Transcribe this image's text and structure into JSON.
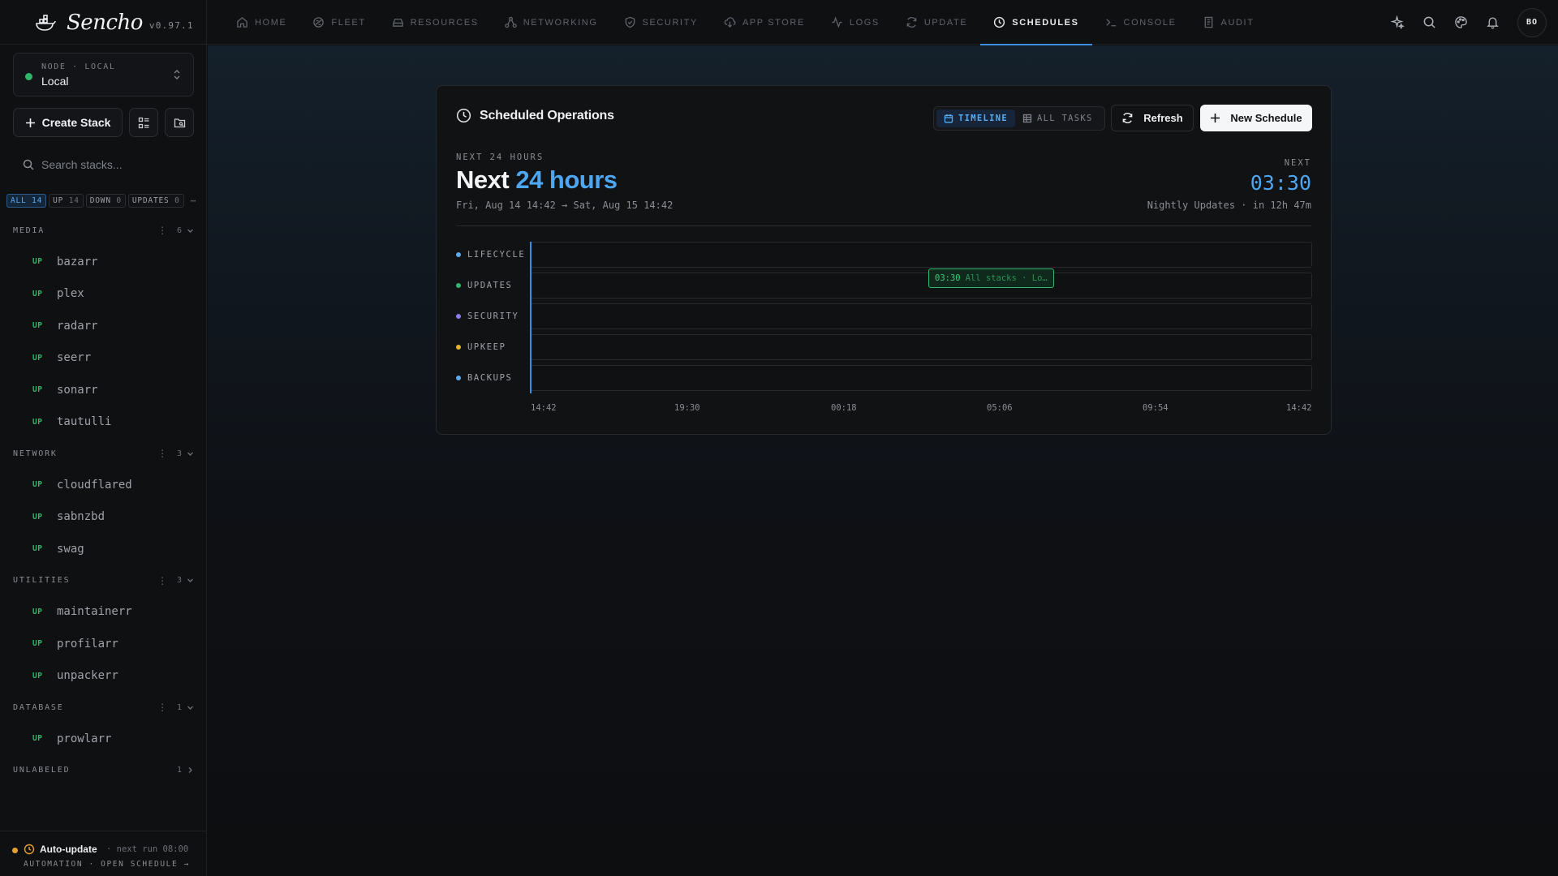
{
  "brand": {
    "name": "Sencho",
    "version": "v0.97.1"
  },
  "nav": [
    {
      "label": "HOME",
      "icon": "home-icon"
    },
    {
      "label": "FLEET",
      "icon": "fleet-icon"
    },
    {
      "label": "RESOURCES",
      "icon": "resources-icon"
    },
    {
      "label": "NETWORKING",
      "icon": "networking-icon"
    },
    {
      "label": "SECURITY",
      "icon": "shield-icon"
    },
    {
      "label": "APP STORE",
      "icon": "cloud-download-icon"
    },
    {
      "label": "LOGS",
      "icon": "activity-icon"
    },
    {
      "label": "UPDATE",
      "icon": "refresh-icon"
    },
    {
      "label": "SCHEDULES",
      "icon": "clock-icon",
      "active": true
    },
    {
      "label": "CONSOLE",
      "icon": "terminal-icon"
    },
    {
      "label": "AUDIT",
      "icon": "audit-icon"
    }
  ],
  "topbar": {
    "avatar_initials": "BO",
    "action_icons": [
      "sparkle-icon",
      "search-icon",
      "palette-icon",
      "bell-icon"
    ]
  },
  "sidebar": {
    "node": {
      "sublabel": "NODE · LOCAL",
      "name": "Local",
      "status_color": "#2fb56a"
    },
    "create_stack_label": "Create Stack",
    "search_placeholder": "Search stacks...",
    "filters": [
      {
        "label": "ALL",
        "count": "14",
        "active": true
      },
      {
        "label": "UP",
        "count": "14"
      },
      {
        "label": "DOWN",
        "count": "0"
      },
      {
        "label": "UPDATES",
        "count": "0"
      }
    ],
    "groups": [
      {
        "name": "MEDIA",
        "count": "6",
        "expanded": true,
        "stacks": [
          {
            "status": "UP",
            "name": "bazarr"
          },
          {
            "status": "UP",
            "name": "plex"
          },
          {
            "status": "UP",
            "name": "radarr"
          },
          {
            "status": "UP",
            "name": "seerr"
          },
          {
            "status": "UP",
            "name": "sonarr"
          },
          {
            "status": "UP",
            "name": "tautulli"
          }
        ]
      },
      {
        "name": "NETWORK",
        "count": "3",
        "expanded": true,
        "stacks": [
          {
            "status": "UP",
            "name": "cloudflared"
          },
          {
            "status": "UP",
            "name": "sabnzbd"
          },
          {
            "status": "UP",
            "name": "swag"
          }
        ]
      },
      {
        "name": "UTILITIES",
        "count": "3",
        "expanded": true,
        "stacks": [
          {
            "status": "UP",
            "name": "maintainerr"
          },
          {
            "status": "UP",
            "name": "profilarr"
          },
          {
            "status": "UP",
            "name": "unpackerr"
          }
        ]
      },
      {
        "name": "DATABASE",
        "count": "1",
        "expanded": true,
        "stacks": [
          {
            "status": "UP",
            "name": "prowlarr"
          }
        ]
      },
      {
        "name": "UNLABELED",
        "count": "1",
        "expanded": false,
        "stacks": []
      }
    ],
    "footer": {
      "title": "Auto-update",
      "next_run": "· next run 08:00",
      "links": "AUTOMATION · OPEN SCHEDULE →",
      "status_color": "#e4a032"
    }
  },
  "schedules": {
    "title": "Scheduled Operations",
    "views": [
      {
        "label": "TIMELINE",
        "icon": "calendar-icon",
        "active": true
      },
      {
        "label": "ALL TASKS",
        "icon": "table-icon"
      }
    ],
    "refresh_label": "Refresh",
    "new_label": "New Schedule",
    "eyebrow": "NEXT 24 HOURS",
    "headline_prefix": "Next",
    "headline_accent": "24 hours",
    "range": "Fri, Aug 14 14:42 → Sat, Aug 15 14:42",
    "next_label": "NEXT",
    "next_time": "03:30",
    "next_desc": "Nightly Updates · in 12h 47m",
    "lanes": [
      {
        "label": "LIFECYCLE",
        "color": "#5aaaf0"
      },
      {
        "label": "UPDATES",
        "color": "#2fb56a"
      },
      {
        "label": "SECURITY",
        "color": "#8b7cf0"
      },
      {
        "label": "UPKEEP",
        "color": "#e4b432"
      },
      {
        "label": "BACKUPS",
        "color": "#5aaaf0"
      }
    ],
    "event": {
      "lane": "UPDATES",
      "time": "03:30",
      "label": "All stacks · Lo…",
      "color": "#2fb56a"
    },
    "axis_ticks": [
      "14:42",
      "19:30",
      "00:18",
      "05:06",
      "09:54",
      "14:42"
    ]
  }
}
